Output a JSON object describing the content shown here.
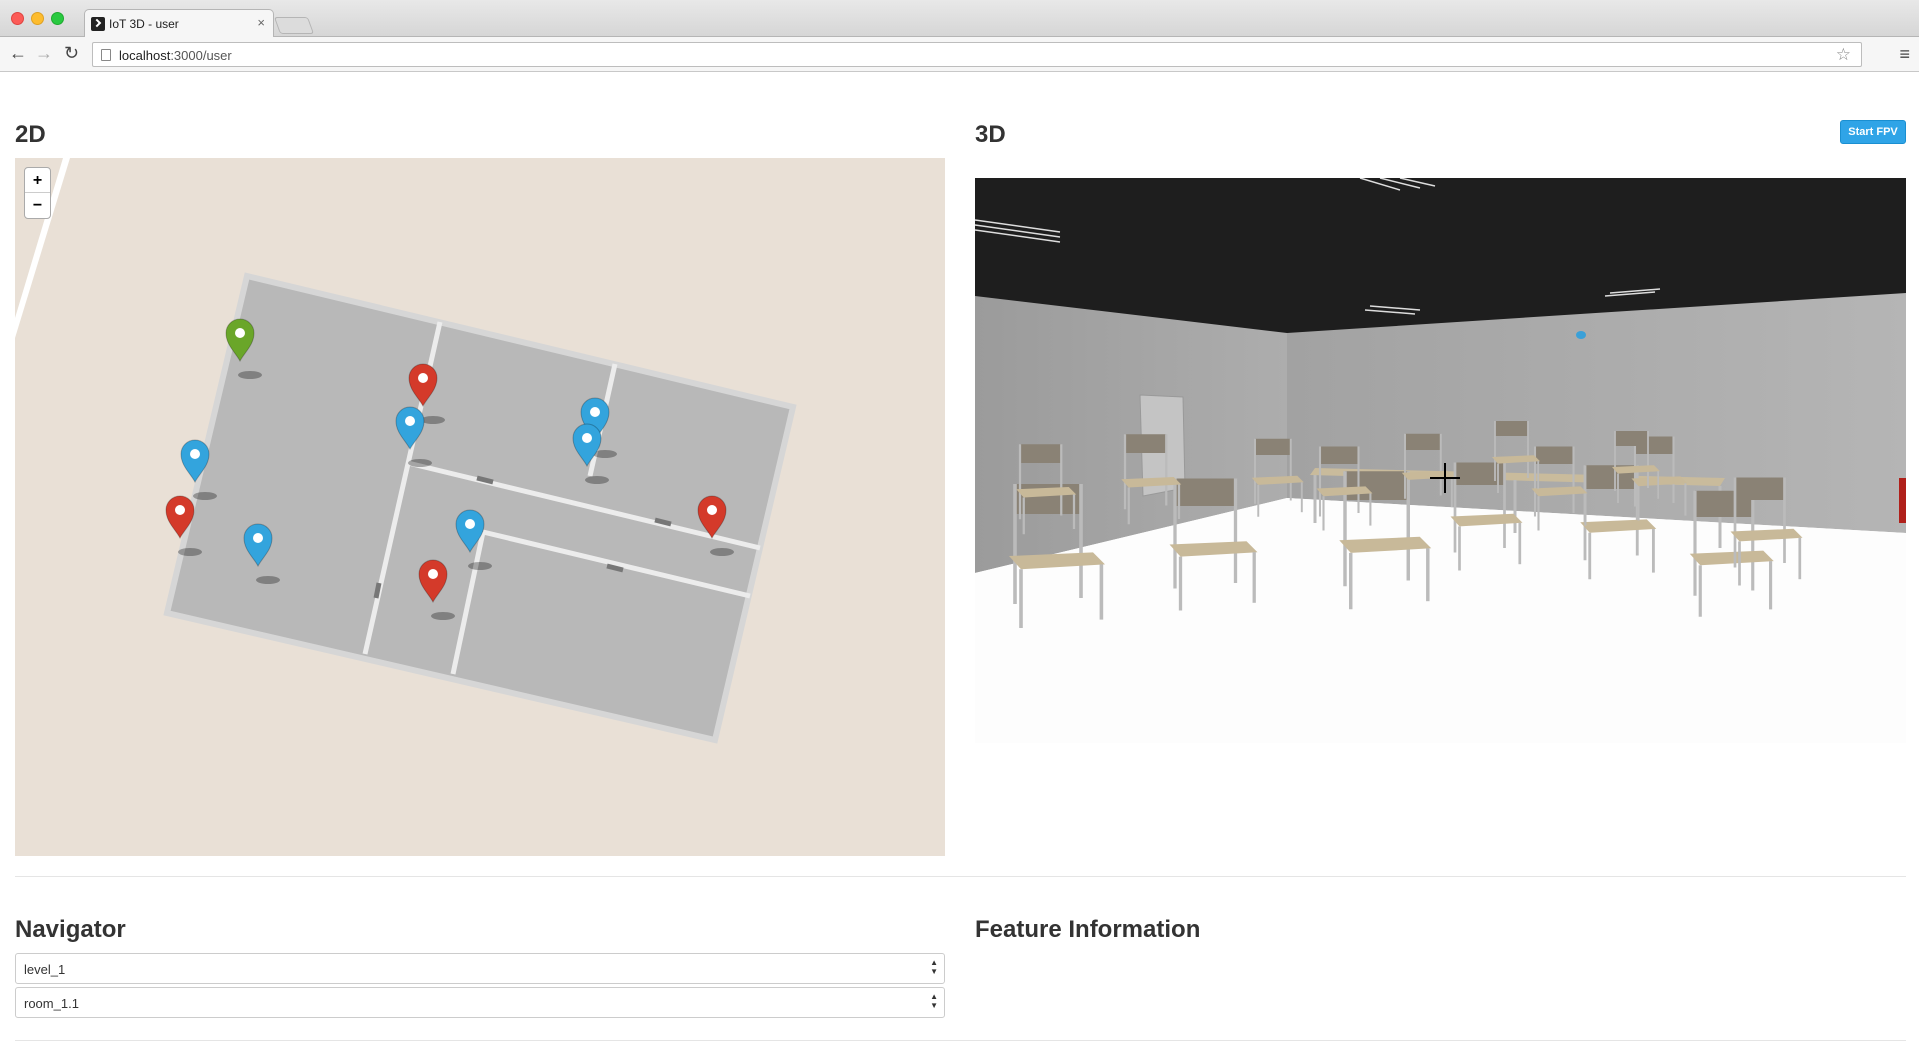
{
  "browser": {
    "tab_title": "IoT 3D - user",
    "tab_close": "×",
    "url_host": "localhost",
    "url_rest": ":3000/user",
    "back": "←",
    "forward": "→",
    "reload": "↻",
    "star": "☆",
    "menu": "≡"
  },
  "panels": {
    "map_title": "2D",
    "view_title": "3D",
    "fpv_button": "Start FPV",
    "zoom_in": "+",
    "zoom_out": "−"
  },
  "map_markers": [
    {
      "type": "location",
      "color": "#6aa629",
      "icon": "navigation-arrow-icon"
    },
    {
      "type": "fire-extinguisher",
      "color": "#d43a2a",
      "icon": "fire-extinguisher-icon"
    },
    {
      "type": "camera",
      "color": "#33a4dd",
      "icon": "camera-icon"
    },
    {
      "type": "wifi",
      "color": "#33a4dd",
      "icon": "wifi-icon"
    },
    {
      "type": "signal",
      "color": "#33a4dd",
      "icon": "signal-icon"
    },
    {
      "type": "wifi",
      "color": "#33a4dd",
      "icon": "wifi-icon"
    },
    {
      "type": "fire-extinguisher",
      "color": "#d43a2a",
      "icon": "fire-extinguisher-icon"
    },
    {
      "type": "camera",
      "color": "#33a4dd",
      "icon": "camera-icon"
    },
    {
      "type": "wifi",
      "color": "#33a4dd",
      "icon": "wifi-icon"
    },
    {
      "type": "fire-extinguisher",
      "color": "#d43a2a",
      "icon": "fire-extinguisher-icon"
    },
    {
      "type": "fire-extinguisher",
      "color": "#d43a2a",
      "icon": "fire-extinguisher-icon"
    }
  ],
  "navigator": {
    "title": "Navigator",
    "level_select": "level_1",
    "room_select": "room_1.1"
  },
  "feature_info": {
    "title": "Feature Information"
  },
  "colors": {
    "map_background": "#e9e0d6",
    "room_fill": "#b8b8b8",
    "ceiling": "#1e1e1e",
    "wall": "#a8a8a8",
    "accent_button": "#2fa4e7"
  }
}
